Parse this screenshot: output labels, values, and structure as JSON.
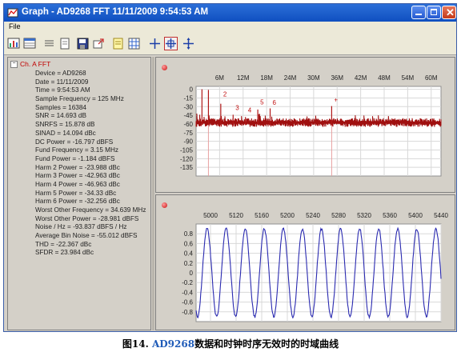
{
  "window": {
    "title": "Graph - AD9268 FFT 11/11/2009 9:54:53 AM"
  },
  "menu": {
    "file": "File"
  },
  "toolbar": {
    "icons": [
      "chart-icon",
      "table-icon",
      "list-icon",
      "print-preview-icon",
      "save-icon",
      "export-icon",
      "notes-icon",
      "grid-icon",
      "cursor-icon",
      "zoom-box-icon",
      "pan-icon"
    ]
  },
  "tree": {
    "root_label": "Ch. A FFT",
    "items": [
      "Device = AD9268",
      "Date = 11/11/2009",
      "Time = 9:54:53 AM",
      "Sample Frequency = 125 MHz",
      "Samples = 16384",
      "SNR = 14.693 dB",
      "SNRFS = 15.878 dB",
      "SINAD = 14.094 dBc",
      "DC Power = -16.797 dBFS",
      "Fund Frequency = 3.15 MHz",
      "Fund Power = -1.184 dBFS",
      "Harm 2 Power = -23.988 dBc",
      "Harm 3 Power = -42.963 dBc",
      "Harm 4 Power = -46.963 dBc",
      "Harm 5 Power = -34.33 dBc",
      "Harm 6 Power = -32.256 dBc",
      "Worst Other Frequency = 34.639 MHz",
      "Worst Other Power = -28.981 dBFS",
      "Noise / Hz = -93.837 dBFS / Hz",
      "Average Bin Noise = -55.012 dBFS",
      "THD = -22.367 dBc",
      "SFDR = 23.984 dBc"
    ]
  },
  "chart_data": [
    {
      "type": "line",
      "name": "fft",
      "x_ticks": [
        "6M",
        "12M",
        "18M",
        "24M",
        "30M",
        "36M",
        "42M",
        "48M",
        "54M",
        "60M"
      ],
      "x_tick_values": [
        6,
        12,
        18,
        24,
        30,
        36,
        42,
        48,
        54,
        60
      ],
      "xlim": [
        0,
        62.5
      ],
      "y_ticks": [
        0,
        -15,
        -30,
        -45,
        -60,
        -75,
        -90,
        -105,
        -120,
        -135
      ],
      "ylim": [
        -150,
        5
      ],
      "noise_floor": [
        -65,
        -50
      ],
      "spurs": [
        {
          "x": 1.5,
          "y": 0
        },
        {
          "x": 3.15,
          "y": -1
        },
        {
          "x": 6.3,
          "y": -25
        },
        {
          "x": 9.45,
          "y": -44
        },
        {
          "x": 12.6,
          "y": -48
        },
        {
          "x": 15.75,
          "y": -35
        },
        {
          "x": 18.9,
          "y": -33
        },
        {
          "x": 34.6,
          "y": -29
        }
      ],
      "harmonic_labels": [
        {
          "text": "2",
          "x": 6.3,
          "y": -12
        },
        {
          "text": "3",
          "x": 9.45,
          "y": -36
        },
        {
          "text": "4",
          "x": 12.6,
          "y": -40
        },
        {
          "text": "5",
          "x": 15.75,
          "y": -26
        },
        {
          "text": "6",
          "x": 18.9,
          "y": -27
        },
        {
          "text": "+",
          "x": 34.6,
          "y": -22
        }
      ],
      "grid": true
    },
    {
      "type": "line",
      "name": "time-domain",
      "x_ticks": [
        "5000",
        "5120",
        "5160",
        "5200",
        "5240",
        "5280",
        "5320",
        "5360",
        "5400",
        "5440"
      ],
      "xlim": [
        4965,
        5475
      ],
      "y_ticks": [
        0.8,
        0.6,
        0.4,
        0.2,
        0,
        -0.2,
        -0.4,
        -0.6,
        -0.8
      ],
      "ylim": [
        -1.0,
        1.0
      ],
      "sine": {
        "amplitude": 0.9,
        "period_samples": 39.7,
        "phase_sample": 4978
      },
      "grid": true
    }
  ],
  "caption": {
    "prefix": "图14. ",
    "device": "AD9268",
    "text": "数据和时钟时序无效时的时域曲线"
  }
}
